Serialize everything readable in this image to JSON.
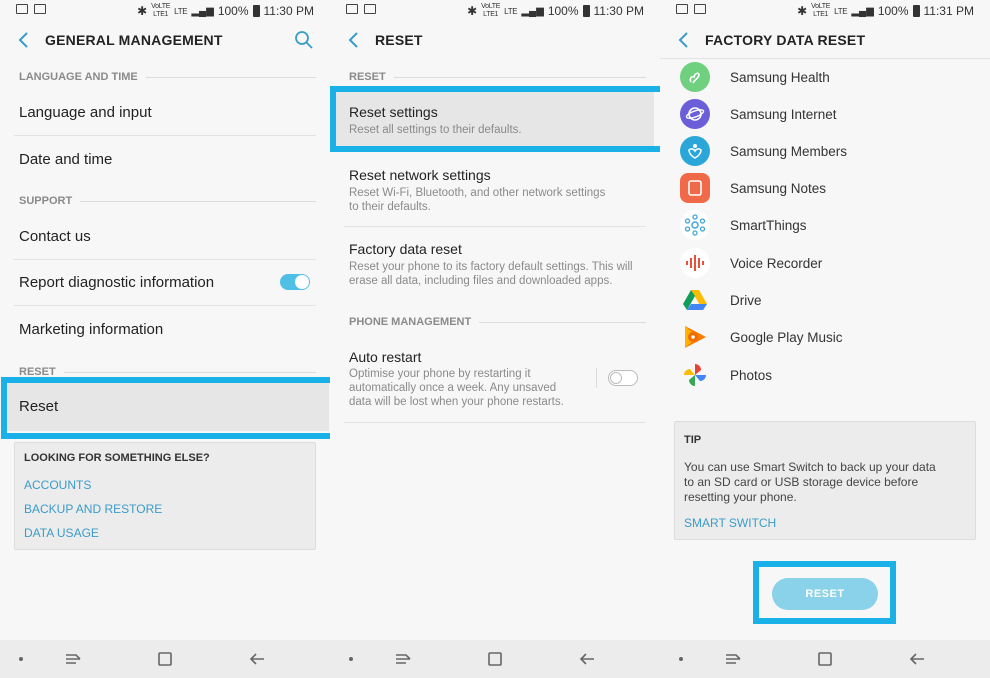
{
  "status": {
    "screen1_time": "11:30 PM",
    "screen2_time": "11:30 PM",
    "screen3_time": "11:31 PM",
    "battery": "100%",
    "net_lte": "LTE",
    "net_volte_top": "VoLTE",
    "net_volte_bottom": "LTE1"
  },
  "colors": {
    "accent": "#4fbfe6",
    "highlight": "#1ab0e8",
    "link": "#3a9cc9"
  },
  "screen1": {
    "title": "GENERAL MANAGEMENT",
    "section_language": "LANGUAGE AND TIME",
    "language_input": "Language and input",
    "date_time": "Date and time",
    "section_support": "SUPPORT",
    "contact_us": "Contact us",
    "report_diagnostic": "Report diagnostic information",
    "report_diagnostic_on": true,
    "marketing": "Marketing information",
    "section_reset": "RESET",
    "reset": "Reset",
    "looking_title": "LOOKING FOR SOMETHING ELSE?",
    "links": [
      "ACCOUNTS",
      "BACKUP AND RESTORE",
      "DATA USAGE"
    ]
  },
  "screen2": {
    "title": "RESET",
    "section_reset": "RESET",
    "reset_settings": {
      "title": "Reset settings",
      "desc": "Reset all settings to their defaults."
    },
    "reset_network": {
      "title": "Reset network settings",
      "desc_line1": "Reset Wi-Fi, Bluetooth, and other network settings",
      "desc_line2": "to their defaults."
    },
    "factory_reset": {
      "title": "Factory data reset",
      "desc_line1": "Reset your phone to its factory default settings. This will",
      "desc_line2": "erase all data, including files and downloaded apps."
    },
    "section_phone": "PHONE MANAGEMENT",
    "auto_restart": {
      "title": "Auto restart",
      "desc_line1": "Optimise your phone by restarting it",
      "desc_line2": "automatically once a week. Any unsaved",
      "desc_line3": "data will be lost when your phone restarts.",
      "on": false
    }
  },
  "screen3": {
    "title": "FACTORY DATA RESET",
    "apps": [
      {
        "name": "Samsung Health",
        "icon": "samsung-health-icon",
        "color": "#6fd080"
      },
      {
        "name": "Samsung Internet",
        "icon": "samsung-internet-icon",
        "color": "#6a5fd8"
      },
      {
        "name": "Samsung Members",
        "icon": "samsung-members-icon",
        "color": "#2aa7d8"
      },
      {
        "name": "Samsung Notes",
        "icon": "samsung-notes-icon",
        "color": "#f06a4a"
      },
      {
        "name": "SmartThings",
        "icon": "smartthings-icon",
        "color": "#ffffff"
      },
      {
        "name": "Voice Recorder",
        "icon": "voice-recorder-icon",
        "color": "#ffffff"
      },
      {
        "name": "Drive",
        "icon": "drive-icon",
        "color": "#ffffff"
      },
      {
        "name": "Google Play Music",
        "icon": "google-play-music-icon",
        "color": "#ffffff"
      },
      {
        "name": "Photos",
        "icon": "photos-icon",
        "color": "#ffffff"
      }
    ],
    "tip_title": "TIP",
    "tip_line1": "You can use Smart Switch to back up your data",
    "tip_line2": "to an SD card or USB storage device before",
    "tip_line3": "resetting your phone.",
    "tip_link": "SMART SWITCH",
    "reset_button": "RESET"
  }
}
